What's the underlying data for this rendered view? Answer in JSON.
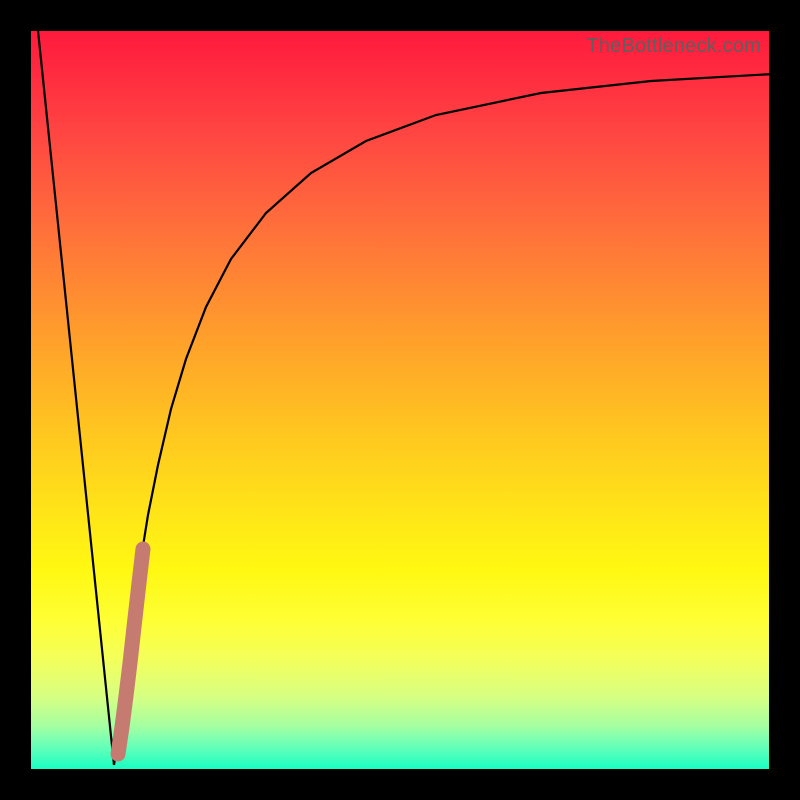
{
  "watermark": "TheBottleneck.com",
  "colors": {
    "background": "#000000",
    "curve_stroke": "#000000",
    "hump_stroke": "#c67b71",
    "gradient_stops": [
      "#ff1a3d",
      "#ff2c40",
      "#ff4642",
      "#ff6a3c",
      "#ff8a32",
      "#ffaa28",
      "#ffc81f",
      "#ffe418",
      "#fff812",
      "#feff35",
      "#f4ff5a",
      "#d8ff80",
      "#a8ffa0",
      "#66ffb8",
      "#18ffc2"
    ]
  },
  "chart_data": {
    "type": "line",
    "title": "",
    "xlabel": "",
    "ylabel": "",
    "xlim": [
      0,
      100
    ],
    "ylim": [
      0,
      100
    ],
    "notes": "V-shaped performance curve. Left branch descends steeply from top-left to a minimum near x≈11, then rises along a saturating logarithmic curve toward the upper right. A short thick desaturated-red segment highlights the lower portion of the rising branch.",
    "series": [
      {
        "name": "left-branch",
        "x": [
          0,
          11.2
        ],
        "y": [
          100,
          0.5
        ]
      },
      {
        "name": "right-branch",
        "x": [
          11.2,
          12,
          13,
          14,
          15,
          16,
          18,
          20,
          23,
          27,
          32,
          38,
          45,
          55,
          70,
          85,
          100
        ],
        "y": [
          0.5,
          8,
          18,
          27,
          34,
          40,
          49,
          56,
          63,
          70,
          76,
          81,
          85,
          88.5,
          91.5,
          93,
          94
        ]
      },
      {
        "name": "highlight-hump",
        "x": [
          12.0,
          14.7
        ],
        "y": [
          2.0,
          30.0
        ]
      }
    ]
  }
}
